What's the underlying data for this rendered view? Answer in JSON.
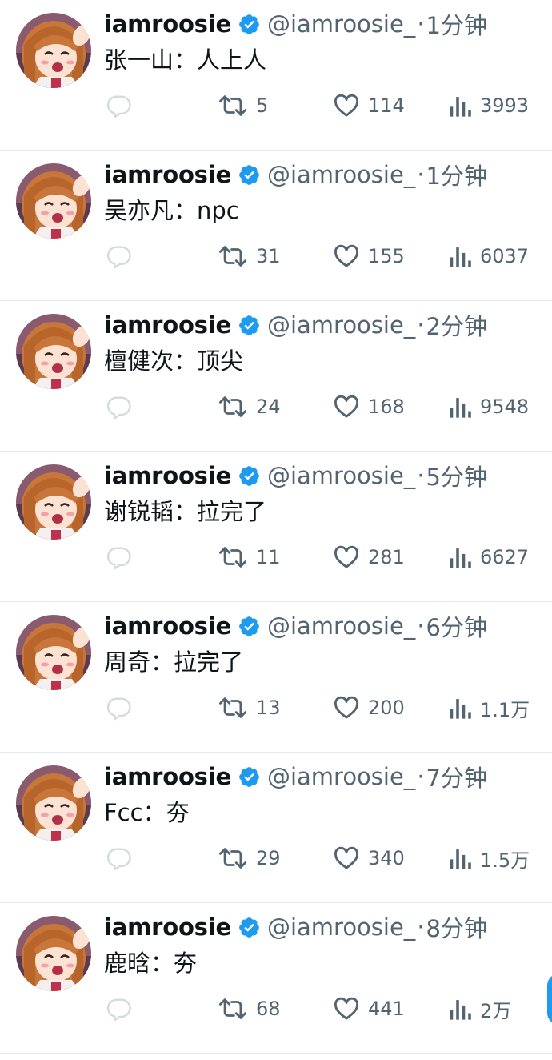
{
  "colors": {
    "accent": "#1d9bf0",
    "text": "#0f1419",
    "secondary": "#536471",
    "divider": "#e6e9ec"
  },
  "icons": {
    "verified": "verified-badge-icon",
    "reply": "reply-icon",
    "retweet": "retweet-icon",
    "like": "heart-icon",
    "views": "views-icon"
  },
  "tweets": [
    {
      "name": "iamroosie",
      "handle": "@iamroosie_",
      "dot": "·",
      "time": "1分钟",
      "text": "张一山：人上人",
      "retweets": "5",
      "likes": "114",
      "views": "3993"
    },
    {
      "name": "iamroosie",
      "handle": "@iamroosie_",
      "dot": "·",
      "time": "1分钟",
      "text": "吴亦凡：npc",
      "retweets": "31",
      "likes": "155",
      "views": "6037"
    },
    {
      "name": "iamroosie",
      "handle": "@iamroosie_",
      "dot": "·",
      "time": "2分钟",
      "text": "檀健次：顶尖",
      "retweets": "24",
      "likes": "168",
      "views": "9548"
    },
    {
      "name": "iamroosie",
      "handle": "@iamroosie_",
      "dot": "·",
      "time": "5分钟",
      "text": "谢锐韬：拉完了",
      "retweets": "11",
      "likes": "281",
      "views": "6627"
    },
    {
      "name": "iamroosie",
      "handle": "@iamroosie_",
      "dot": "·",
      "time": "6分钟",
      "text": "周奇：拉完了",
      "retweets": "13",
      "likes": "200",
      "views": "1.1万"
    },
    {
      "name": "iamroosie",
      "handle": "@iamroosie_",
      "dot": "·",
      "time": "7分钟",
      "text": "Fcc：夯",
      "retweets": "29",
      "likes": "340",
      "views": "1.5万"
    },
    {
      "name": "iamroosie",
      "handle": "@iamroosie_",
      "dot": "·",
      "time": "8分钟",
      "text": "鹿晗：夯",
      "retweets": "68",
      "likes": "441",
      "views": "2万"
    }
  ]
}
